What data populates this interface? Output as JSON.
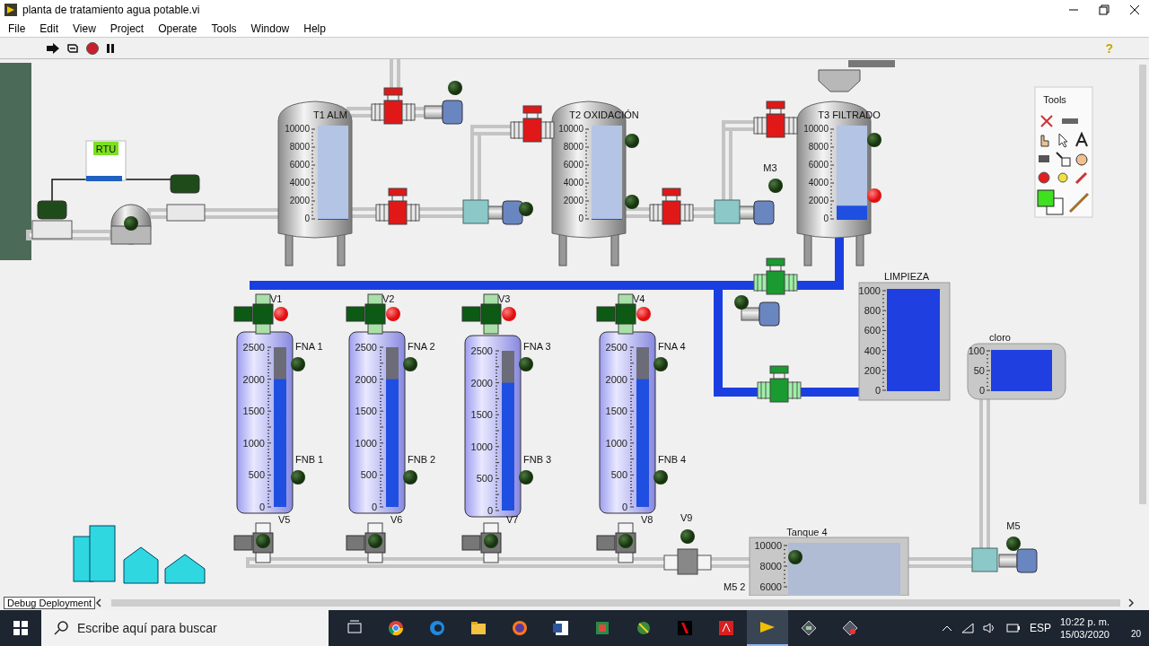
{
  "window": {
    "title": "planta de tratamiento agua potable.vi"
  },
  "menu": [
    "File",
    "Edit",
    "View",
    "Project",
    "Operate",
    "Tools",
    "Window",
    "Help"
  ],
  "toolbar": {
    "help": "?"
  },
  "tanks": [
    {
      "label": "T1 ALM",
      "ticks": [
        "10000",
        "8000",
        "6000",
        "4000",
        "2000",
        "0"
      ],
      "level": 0.01
    },
    {
      "label": "T2 OXIDACIÓN",
      "ticks": [
        "10000",
        "8000",
        "6000",
        "4000",
        "2000",
        "0"
      ],
      "level": 0.01
    },
    {
      "label": "T3 FILTRADO",
      "ticks": [
        "10000",
        "8000",
        "6000",
        "4000",
        "2000",
        "0"
      ],
      "level": 0.15
    }
  ],
  "filters": [
    {
      "valve_label": "V1",
      "valve_open": true,
      "valve_lamp_on": true,
      "fna_label": "FNA 1",
      "fna_on": false,
      "fnb_label": "FNB 1",
      "fnb_on": false,
      "ticks": [
        "2500",
        "2000",
        "1500",
        "1000",
        "500",
        "0"
      ],
      "level": 0.8,
      "drain_label": "V5",
      "drain_open": false,
      "drain_lamp_on": false
    },
    {
      "valve_label": "V2",
      "valve_open": true,
      "valve_lamp_on": true,
      "fna_label": "FNA 2",
      "fna_on": false,
      "fnb_label": "FNB 2",
      "fnb_on": false,
      "ticks": [
        "2500",
        "2000",
        "1500",
        "1000",
        "500",
        "0"
      ],
      "level": 0.8,
      "drain_label": "V6",
      "drain_open": false,
      "drain_lamp_on": false
    },
    {
      "valve_label": "V3",
      "valve_open": true,
      "valve_lamp_on": true,
      "fna_label": "FNA 3",
      "fna_on": false,
      "fnb_label": "FNB 3",
      "fnb_on": false,
      "ticks": [
        "2500",
        "2000",
        "1500",
        "1000",
        "500",
        "0"
      ],
      "level": 0.8,
      "drain_label": "V7",
      "drain_open": false,
      "drain_lamp_on": false
    },
    {
      "valve_label": "V4",
      "valve_open": true,
      "valve_lamp_on": true,
      "fna_label": "FNA 4",
      "fna_on": false,
      "fnb_label": "FNB 4",
      "fnb_on": false,
      "ticks": [
        "2500",
        "2000",
        "1500",
        "1000",
        "500",
        "0"
      ],
      "level": 0.8,
      "drain_label": "V8",
      "drain_open": false,
      "drain_lamp_on": false
    }
  ],
  "flow_valves": [
    {
      "open": false
    },
    {
      "open": false
    },
    {
      "open": false
    },
    {
      "open": false
    },
    {
      "open": false
    },
    {
      "open": true
    },
    {
      "open": true
    }
  ],
  "lamps": [
    {
      "on": false
    },
    {
      "on": false
    },
    {
      "on": false
    },
    {
      "on": false
    },
    {
      "on": false
    },
    {
      "on": true
    },
    {
      "on": false
    },
    {
      "on": false
    },
    {
      "on": false
    },
    {
      "on": false
    },
    {
      "on": false
    },
    {
      "on": false
    }
  ],
  "device_labels": [
    "RTU",
    "M3",
    "V9",
    "M5 2",
    "M5"
  ],
  "limpieza": {
    "label": "LIMPIEZA",
    "ticks": [
      "1000",
      "800",
      "600",
      "400",
      "200",
      "0"
    ],
    "level": 1
  },
  "cloro": {
    "label": "cloro",
    "ticks": [
      "100",
      "50",
      "0"
    ],
    "level": 1
  },
  "tanque4": {
    "label": "Tanque 4",
    "ticks": [
      "10000",
      "8000",
      "6000"
    ]
  },
  "tools_palette": {
    "title": "Tools"
  },
  "status": {
    "label": "Debug Deployment"
  },
  "taskbar": {
    "search_placeholder": "Escribe aquí para buscar",
    "language": "ESP",
    "time": "10:22 p. m.",
    "date": "15/03/2020",
    "notifications": "20"
  }
}
